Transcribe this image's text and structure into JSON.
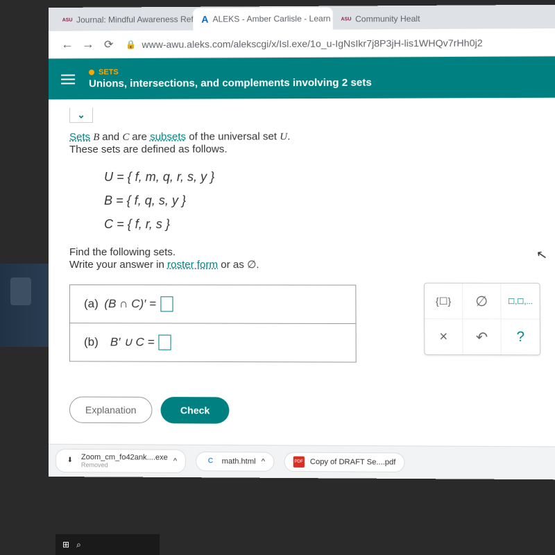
{
  "tabs": [
    {
      "icon": "ASU",
      "icon_color": "#8c1d40",
      "title": "Journal: Mindful Awareness Refle"
    },
    {
      "icon": "A",
      "icon_color": "#0066cc",
      "title": "ALEKS - Amber Carlisle - Learn"
    },
    {
      "icon": "ASU",
      "icon_color": "#8c1d40",
      "title": "Community Healt"
    }
  ],
  "url": "www-awu.aleks.com/alekscgi/x/Isl.exe/1o_u-IgNsIkr7j8P3jH-lis1WHQv7rHh0j2",
  "header": {
    "category": "SETS",
    "topic": "Unions, intersections, and complements involving 2 sets"
  },
  "problem": {
    "intro1": "Sets",
    "intro2": "and",
    "intro3": "are",
    "intro4": "of the universal set",
    "intro5": "These sets are defined as follows.",
    "link_sets": "Sets",
    "link_subsets": "subsets",
    "setU": "U = { f, m, q, r, s, y }",
    "setB": "B = { f, q, s, y }",
    "setC": "C = { f, r, s }",
    "find": "Find the following sets.",
    "write": "Write your answer in",
    "roster_link": "roster form",
    "or_as": "or as",
    "empty_symbol": "∅"
  },
  "questions": {
    "a_label": "(a)",
    "a_expr": "(B ∩ C)′  =",
    "b_label": "(b)",
    "b_expr": "B′ ∪ C  ="
  },
  "tools": {
    "braces": "{☐}",
    "empty": "∅",
    "roster": "☐,☐,...",
    "close": "×",
    "undo": "↶",
    "help": "?"
  },
  "actions": {
    "explanation": "Explanation",
    "check": "Check"
  },
  "downloads": [
    {
      "name": "Zoom_cm_fo42ank....exe",
      "sub": "Removed",
      "icon": "⬇",
      "icon_color": "#666"
    },
    {
      "name": "math.html",
      "sub": "",
      "icon": "C",
      "icon_color": "#0066cc"
    },
    {
      "name": "Copy of DRAFT Se....pdf",
      "sub": "",
      "icon": "PDF",
      "icon_color": "#d93025"
    }
  ]
}
